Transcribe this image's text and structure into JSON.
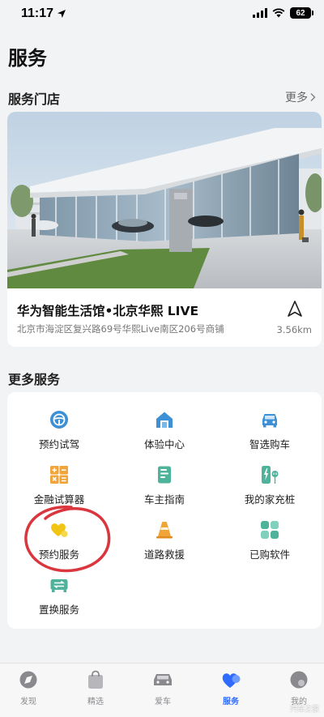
{
  "status_bar": {
    "time": "11:17",
    "battery": "62"
  },
  "page": {
    "title": "服务"
  },
  "store_section": {
    "title": "服务门店",
    "more": "更多",
    "store": {
      "name": "华为智能生活馆•北京华熙 LIVE",
      "address": "北京市海淀区复兴路69号华熙Live南区206号商铺",
      "distance": "3.56km"
    }
  },
  "services_section": {
    "title": "更多服务",
    "items": [
      {
        "label": "预约试驾",
        "icon": "steering-wheel-icon"
      },
      {
        "label": "体验中心",
        "icon": "home-icon"
      },
      {
        "label": "智选购车",
        "icon": "car-icon"
      },
      {
        "label": "金融试算器",
        "icon": "calculator-icon"
      },
      {
        "label": "车主指南",
        "icon": "guide-book-icon"
      },
      {
        "label": "我的家充桩",
        "icon": "charging-pile-icon"
      },
      {
        "label": "预约服务",
        "icon": "heart-service-icon"
      },
      {
        "label": "道路救援",
        "icon": "traffic-cone-icon"
      },
      {
        "label": "已购软件",
        "icon": "apps-grid-icon"
      },
      {
        "label": "置换服务",
        "icon": "trade-in-icon"
      }
    ]
  },
  "tab_bar": {
    "tabs": [
      {
        "label": "发现",
        "icon": "discover-icon"
      },
      {
        "label": "精选",
        "icon": "shopping-bag-icon"
      },
      {
        "label": "爱车",
        "icon": "my-car-icon"
      },
      {
        "label": "服务",
        "icon": "service-heart-icon",
        "active": true
      },
      {
        "label": "我的",
        "icon": "profile-icon"
      }
    ]
  },
  "watermark": "汽车之家",
  "colors": {
    "accent": "#2f6bff",
    "icon_blue": "#3d8fd6",
    "icon_orange": "#f0a53a",
    "icon_green": "#4fb39c",
    "icon_yellow": "#f2c515",
    "annotation_red": "#d9363e"
  }
}
